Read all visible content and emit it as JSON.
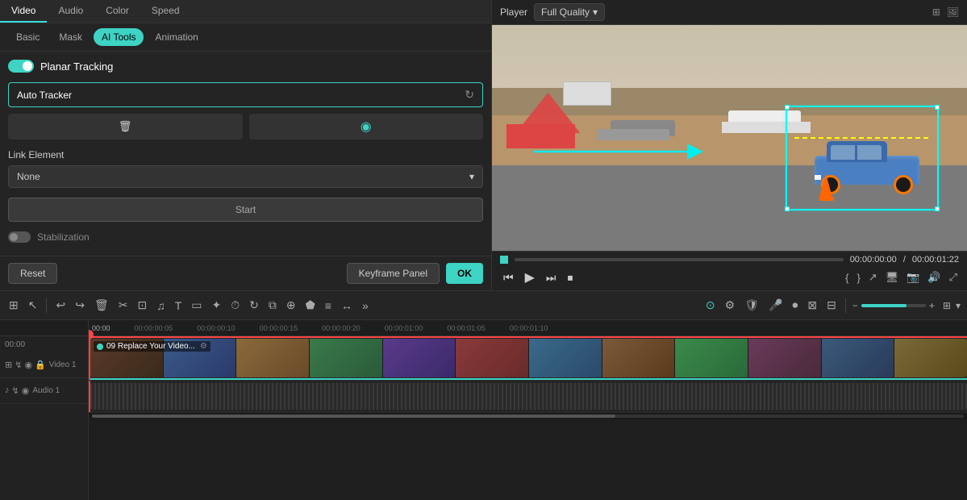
{
  "tabs": {
    "main": [
      "Video",
      "Audio",
      "Color",
      "Speed"
    ],
    "active_main": "Video",
    "sub": [
      "Basic",
      "Mask",
      "AI Tools",
      "Animation"
    ],
    "active_sub": "AI Tools"
  },
  "panel": {
    "planar_tracking_label": "Planar Tracking",
    "auto_tracker_label": "Auto Tracker",
    "link_element_label": "Link Element",
    "link_element_value": "None",
    "start_btn_label": "Start",
    "stabilization_label": "Stabilization",
    "reset_btn": "Reset",
    "keyframe_btn": "Keyframe Panel",
    "ok_btn": "OK"
  },
  "player": {
    "label": "Player",
    "quality": "Full Quality",
    "current_time": "00:00:00:00",
    "total_time": "00:00:01:22",
    "separator": "/"
  },
  "timeline": {
    "ruler_marks": [
      "00:00",
      "00:00:00:05",
      "00:00:00:10",
      "00:00:00:15",
      "00:00:00:20",
      "00:00:01:00",
      "00:00:01:05",
      "00:00:01:10"
    ],
    "video_track_label": "Video 1",
    "audio_track_label": "Audio 1",
    "clip_label": "09 Replace Your Video...",
    "video_track_num": "▣1",
    "audio_track_num": "♪1"
  },
  "icons": {
    "refresh": "↻",
    "delete": "🗑",
    "eye": "◎",
    "chevron_down": "▾",
    "play": "▶",
    "pause": "⏸",
    "step_back": "⏮",
    "step_forward": "⏭",
    "stop": "⏹",
    "volume": "🔊",
    "grid": "⊞",
    "image": "🖼",
    "undo": "↩",
    "redo": "↪",
    "cut": "✂",
    "split": "⊢",
    "text": "T",
    "crop": "⊡",
    "zoom_in": "+",
    "zoom_out": "−",
    "layout": "⊞",
    "magnet": "⊙",
    "settings": "⚙"
  }
}
